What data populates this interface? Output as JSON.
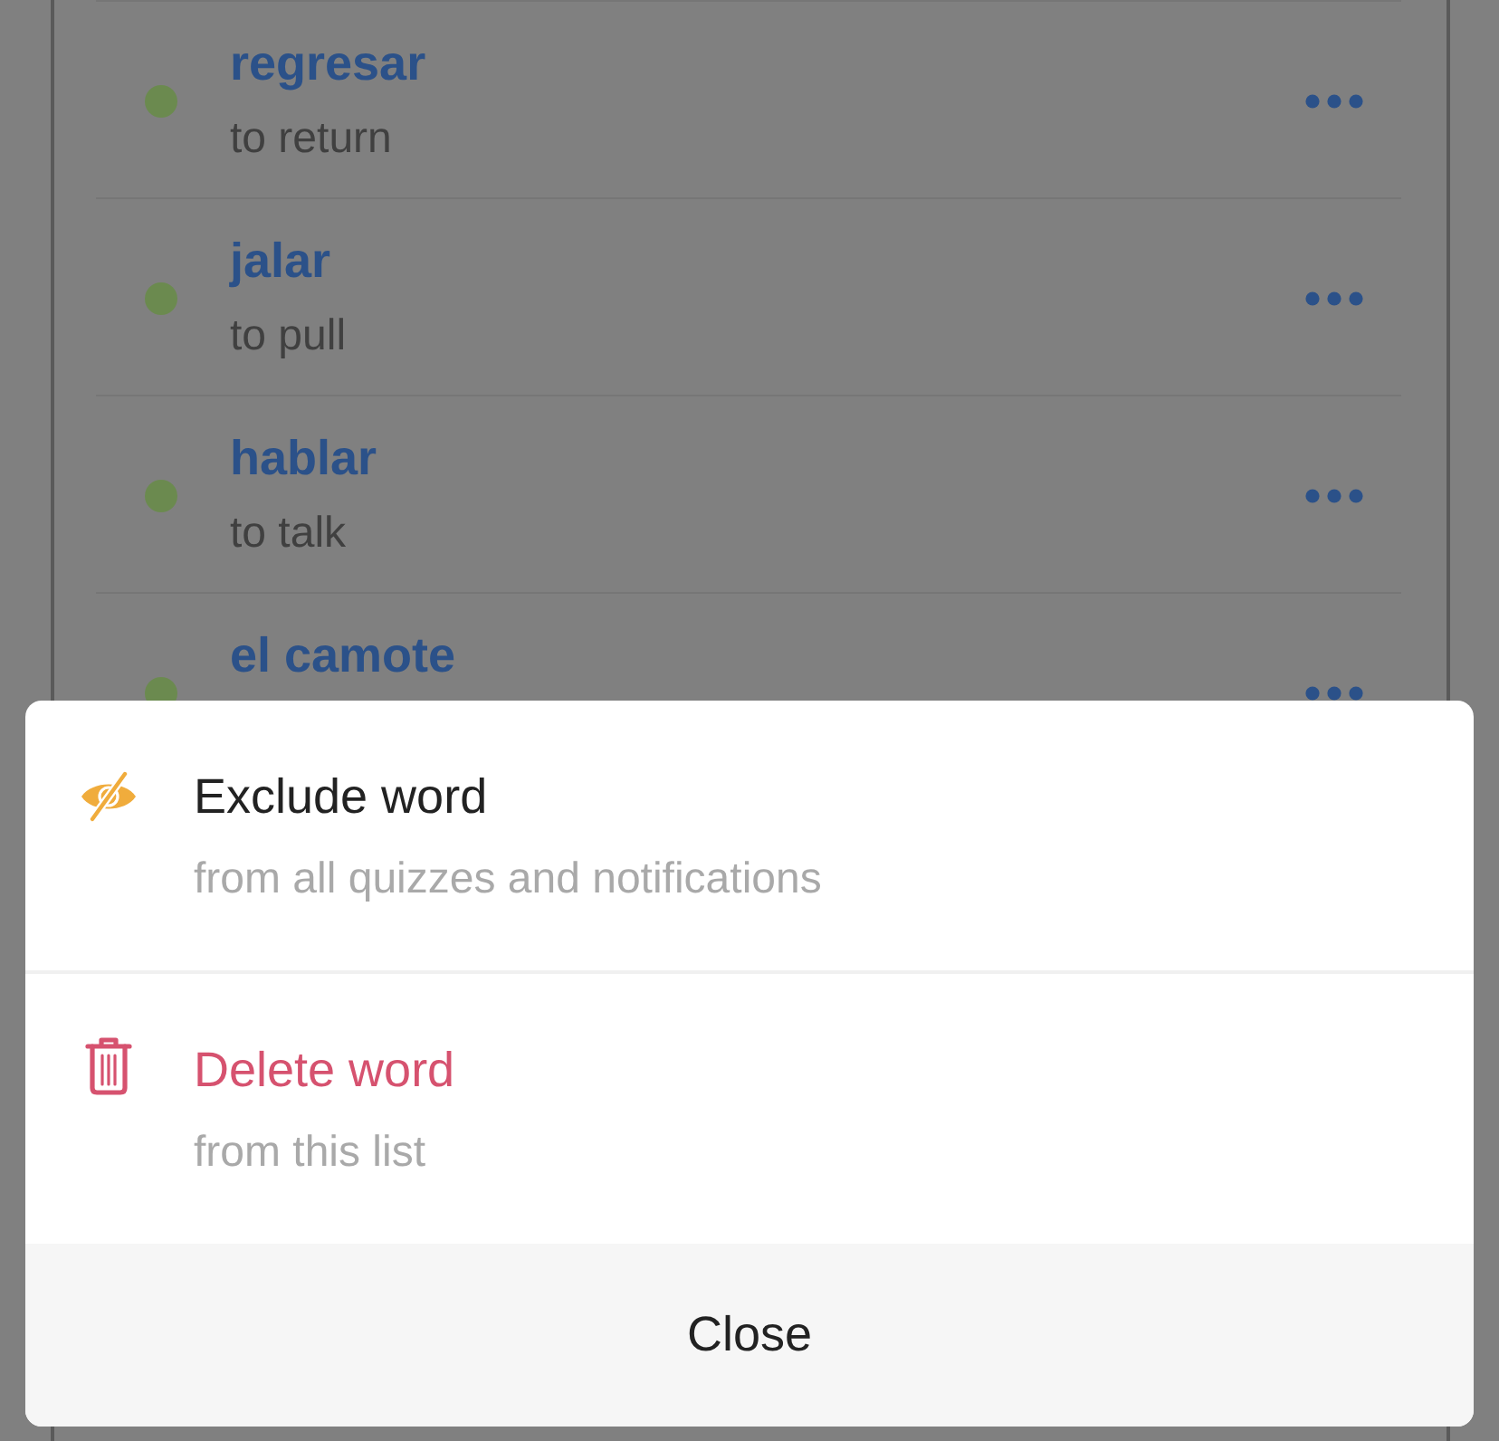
{
  "word_list": {
    "items": [
      {
        "word": "regresar",
        "translation": "to return"
      },
      {
        "word": "jalar",
        "translation": "to pull"
      },
      {
        "word": "hablar",
        "translation": "to talk"
      },
      {
        "word": "el camote"
      }
    ]
  },
  "action_sheet": {
    "actions": [
      {
        "kind": "exclude",
        "title": "Exclude word",
        "subtitle": "from all quizzes and notifications"
      },
      {
        "kind": "delete",
        "title": "Delete word",
        "subtitle": "from this list"
      }
    ],
    "close_label": "Close"
  }
}
